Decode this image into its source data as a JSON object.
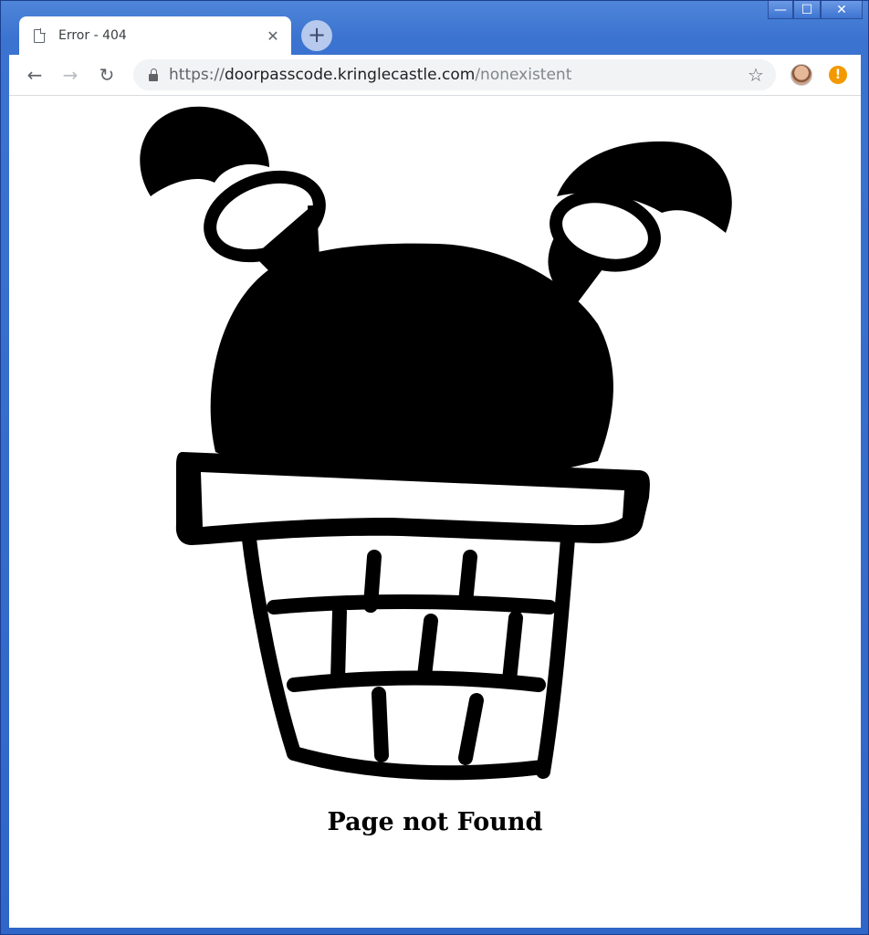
{
  "window": {
    "controls": {
      "minimize": "—",
      "maximize": "☐",
      "close": "✕"
    }
  },
  "tab": {
    "title": "Error - 404",
    "close_glyph": "✕",
    "page_icon": "page-icon"
  },
  "new_tab": {
    "glyph": "+"
  },
  "toolbar": {
    "back_glyph": "←",
    "forward_glyph": "→",
    "reload_glyph": "↻",
    "url_scheme": "https://",
    "url_host": "doorpasscode.kringlecastle.com",
    "url_path": "/nonexistent",
    "star_glyph": "☆",
    "warning_glyph": "!"
  },
  "page": {
    "message": "Page not Found",
    "illustration": "ice-cream-cone-icon"
  },
  "colors": {
    "title_bar": "#3b73d0",
    "tab_bg": "#ffffff",
    "omnibox_bg": "#f1f3f4",
    "warning": "#f29900",
    "text": "#000000"
  }
}
